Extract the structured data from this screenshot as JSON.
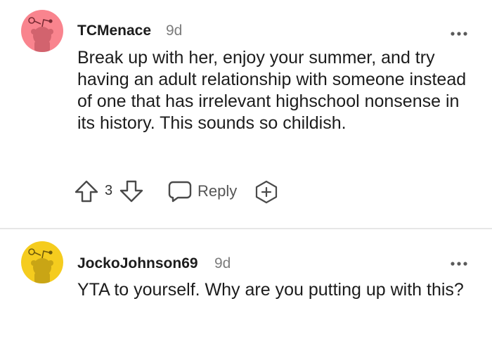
{
  "comments": [
    {
      "username": "TCMenace",
      "time": "9d",
      "avatar_color": "#f9848e",
      "text": "Break up with her, enjoy your summer, and try having an adult relationship with someone instead of one that has irrelevant highschool nonsense in its history. This sounds so childish.",
      "score": "3",
      "reply_label": "Reply"
    },
    {
      "username": "JockoJohnson69",
      "time": "9d",
      "avatar_color": "#f5cc1e",
      "text": "YTA to yourself. Why are you putting up with this?"
    }
  ],
  "icons": {
    "upvote": "up-arrow-icon",
    "downvote": "down-arrow-icon",
    "reply": "speech-bubble-icon",
    "award": "plus-hexagon-icon",
    "more": "ellipsis-icon"
  },
  "colors": {
    "text": "#1c1c1c",
    "muted": "#7c7c7c",
    "divider": "#e6e6e6"
  }
}
